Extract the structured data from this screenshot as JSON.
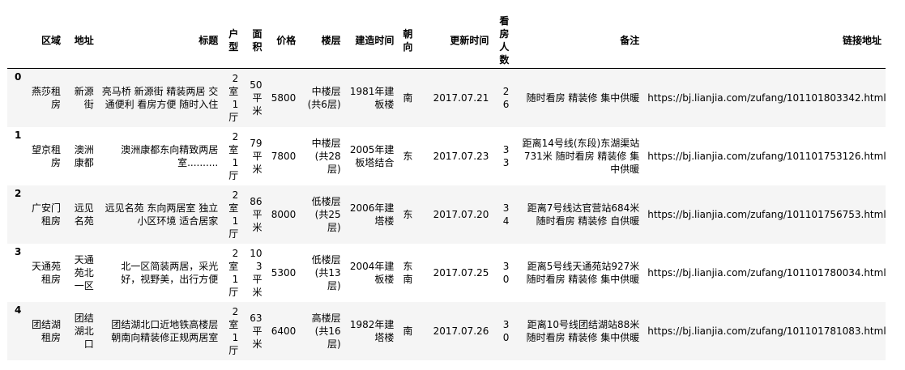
{
  "columns": {
    "index": "",
    "district": "区域",
    "address": "地址",
    "title": "标题",
    "layout": "户型",
    "area": "面积",
    "price": "价格",
    "floor": "楼层",
    "built": "建造时间",
    "orientation": "朝向",
    "updated": "更新时间",
    "viewers": "看房人数",
    "notes": "备注",
    "link": "链接地址"
  },
  "rows": [
    {
      "index": "0",
      "district": "燕莎租房",
      "address": "新源街",
      "title": "亮马桥 新源街 精装两居 交通便利 看房方便 随时入住",
      "layout": "2室1厅",
      "area": "50平米",
      "price": "5800",
      "floor": "中楼层(共6层)",
      "built": "1981年建板楼",
      "orientation": "南",
      "updated": "2017.07.21",
      "viewers": "26",
      "notes": "随时看房 精装修 集中供暖",
      "link": "https://bj.lianjia.com/zufang/101101803342.html"
    },
    {
      "index": "1",
      "district": "望京租房",
      "address": "澳洲康都",
      "title": "澳洲康都东向精致两居室..........",
      "layout": "2室1厅",
      "area": "79平米",
      "price": "7800",
      "floor": "中楼层(共28层)",
      "built": "2005年建板塔结合",
      "orientation": "东",
      "updated": "2017.07.23",
      "viewers": "33",
      "notes": "距离14号线(东段)东湖渠站731米 随时看房 精装修 集中供暖",
      "link": "https://bj.lianjia.com/zufang/101101753126.html"
    },
    {
      "index": "2",
      "district": "广安门租房",
      "address": "远见名苑",
      "title": "远见名苑 东向两居室 独立小区环境 适合居家",
      "layout": "2室1厅",
      "area": "86平米",
      "price": "8000",
      "floor": "低楼层(共25层)",
      "built": "2006年建塔楼",
      "orientation": "东",
      "updated": "2017.07.20",
      "viewers": "34",
      "notes": "距离7号线达官营站684米 随时看房 精装修 自供暖",
      "link": "https://bj.lianjia.com/zufang/101101756753.html"
    },
    {
      "index": "3",
      "district": "天通苑租房",
      "address": "天通苑北一区",
      "title": "北一区简装两居，采光好，视野美，出行方便",
      "layout": "2室1厅",
      "area": "103平米",
      "price": "5300",
      "floor": "低楼层(共13层)",
      "built": "2004年建板楼",
      "orientation": "东南",
      "updated": "2017.07.25",
      "viewers": "30",
      "notes": "距离5号线天通苑站927米 随时看房 精装修 集中供暖",
      "link": "https://bj.lianjia.com/zufang/101101780034.html"
    },
    {
      "index": "4",
      "district": "团结湖租房",
      "address": "团结湖北口",
      "title": "团结湖北口近地铁高楼层朝南向精装修正规两居室",
      "layout": "2室1厅",
      "area": "63平米",
      "price": "6400",
      "floor": "高楼层(共16层)",
      "built": "1982年建塔楼",
      "orientation": "南",
      "updated": "2017.07.26",
      "viewers": "30",
      "notes": "距离10号线团结湖站88米 随时看房 精装修 集中供暖",
      "link": "https://bj.lianjia.com/zufang/101101781083.html"
    }
  ]
}
